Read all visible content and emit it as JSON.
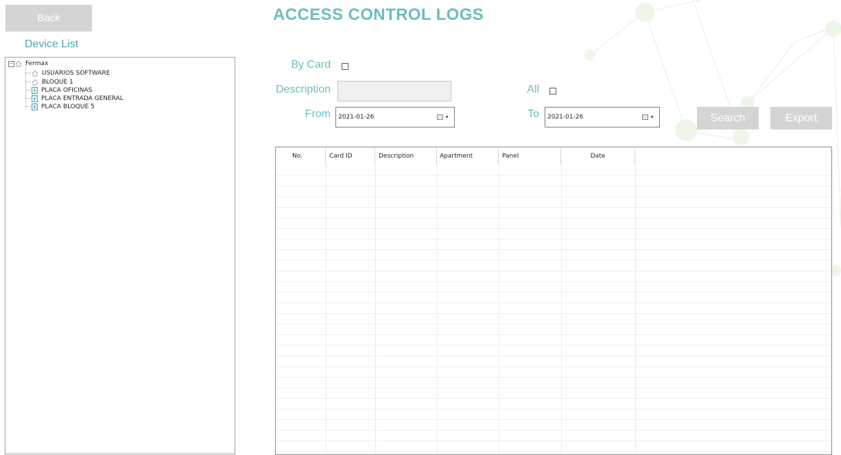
{
  "header": {
    "back_label": "Back",
    "title": "ACCESS CONTROL LOGS"
  },
  "sidebar": {
    "title": "Device List",
    "tree": {
      "root": {
        "label": "Fermax",
        "icon": "house-icon",
        "expanded": true
      },
      "items": [
        {
          "label": "USUARIOS SOFTWARE",
          "icon": "house-icon"
        },
        {
          "label": "BLOQUE 1",
          "icon": "house-icon"
        },
        {
          "label": "PLACA OFICINAS",
          "icon": "door-panel-icon"
        },
        {
          "label": "PLACA ENTRADA GENERAL",
          "icon": "door-panel-icon"
        },
        {
          "label": "PLACA BLOQUE 5",
          "icon": "door-panel-icon"
        }
      ]
    }
  },
  "filters": {
    "by_card_label": "By Card",
    "by_card_checked": false,
    "description_label": "Description",
    "description_value": "",
    "all_label": "All",
    "all_checked": false,
    "from_label": "From",
    "from_value": "2021-01-26",
    "to_label": "To",
    "to_value": "2021-01-26"
  },
  "actions": {
    "search_label": "Search",
    "export_label": "Export"
  },
  "grid": {
    "columns": [
      "No.",
      "Card ID",
      "Description",
      "Apartment",
      "Panel",
      "Date"
    ],
    "rows": []
  },
  "colors": {
    "accent": "#6cbcbf",
    "button_bg": "#d4d4d4",
    "button_text": "#ffffff"
  }
}
